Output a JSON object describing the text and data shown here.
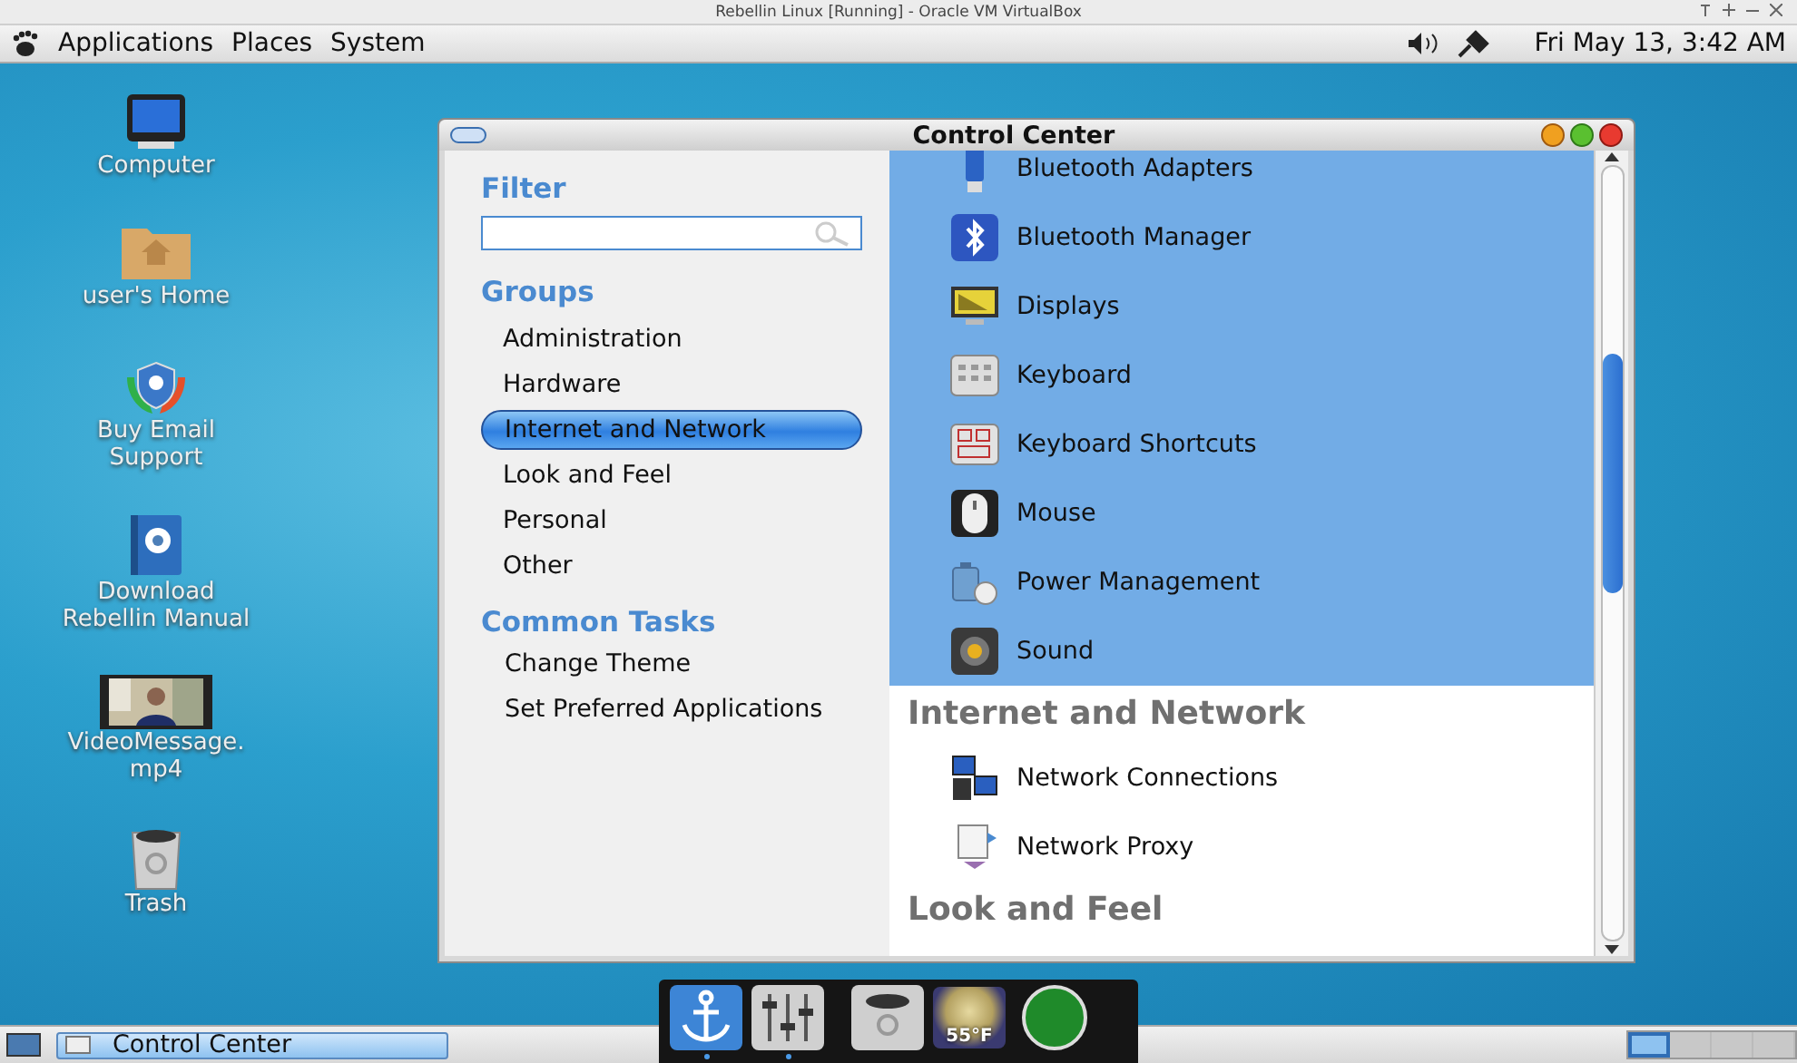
{
  "vm_window": {
    "title": "Rebellin Linux [Running] - Oracle VM VirtualBox"
  },
  "top_panel": {
    "menus": [
      "Applications",
      "Places",
      "System"
    ],
    "clock": "Fri May 13,  3:42 AM"
  },
  "desktop_icons": [
    {
      "kind": "computer",
      "label": "Computer"
    },
    {
      "kind": "home",
      "label": "user's Home"
    },
    {
      "kind": "support",
      "label": "Buy Email Support"
    },
    {
      "kind": "manual",
      "label": "Download Rebellin Manual"
    },
    {
      "kind": "video",
      "label": "VideoMessage. mp4"
    },
    {
      "kind": "trash",
      "label": "Trash"
    }
  ],
  "window": {
    "title": "Control Center",
    "filter": {
      "heading": "Filter"
    },
    "groups_heading": "Groups",
    "groups": [
      {
        "label": "Administration",
        "selected": false
      },
      {
        "label": "Hardware",
        "selected": false
      },
      {
        "label": "Internet and Network",
        "selected": true
      },
      {
        "label": "Look and Feel",
        "selected": false
      },
      {
        "label": "Personal",
        "selected": false
      },
      {
        "label": "Other",
        "selected": false
      }
    ],
    "tasks_heading": "Common Tasks",
    "tasks": [
      "Change Theme",
      "Set Preferred Applications"
    ],
    "sections": [
      {
        "highlighted": true,
        "items": [
          {
            "kind": "usb",
            "label": "Bluetooth Adapters"
          },
          {
            "kind": "bluetooth",
            "label": "Bluetooth Manager"
          },
          {
            "kind": "display",
            "label": "Displays"
          },
          {
            "kind": "keyboard",
            "label": "Keyboard"
          },
          {
            "kind": "shortcuts",
            "label": "Keyboard Shortcuts"
          },
          {
            "kind": "mouse",
            "label": "Mouse"
          },
          {
            "kind": "power",
            "label": "Power Management"
          },
          {
            "kind": "sound",
            "label": "Sound"
          }
        ]
      },
      {
        "title": "Internet and Network",
        "highlighted": false,
        "items": [
          {
            "kind": "network",
            "label": "Network Connections"
          },
          {
            "kind": "proxy",
            "label": "Network Proxy"
          }
        ]
      },
      {
        "title": "Look and Feel",
        "highlighted": false
      }
    ]
  },
  "dock": [
    {
      "kind": "anchor",
      "running": true
    },
    {
      "kind": "mixer",
      "running": true
    },
    {
      "kind": "trash",
      "running": false
    },
    {
      "kind": "weather",
      "label": "55°F",
      "running": false
    },
    {
      "kind": "orb",
      "running": false
    }
  ],
  "bottom_panel": {
    "task": "Control Center",
    "workspaces": [
      {
        "selected": true
      },
      {
        "selected": false
      },
      {
        "selected": false
      },
      {
        "selected": false
      }
    ]
  }
}
